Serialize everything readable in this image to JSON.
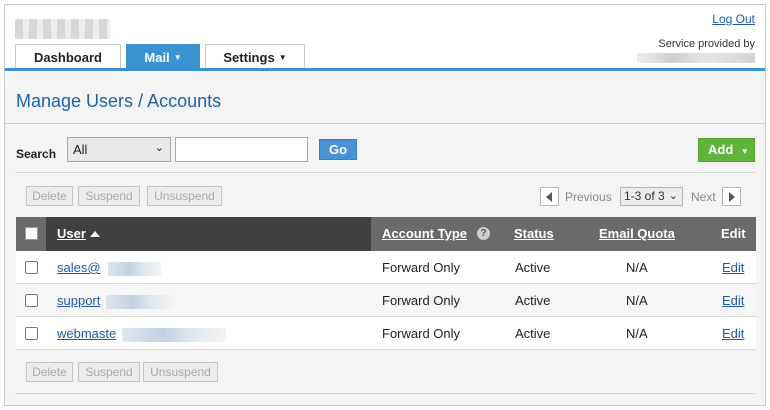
{
  "header": {
    "logout_label": "Log Out",
    "service_provided_label": "Service provided by"
  },
  "tabs": [
    {
      "label": "Dashboard",
      "active": false
    },
    {
      "label": "Mail",
      "active": true,
      "has_dropdown": true
    },
    {
      "label": "Settings",
      "active": false,
      "has_dropdown": true
    }
  ],
  "page_title": "Manage Users / Accounts",
  "toolbar": {
    "search_label": "Search",
    "filter_value": "All",
    "search_placeholder": "",
    "go_label": "Go",
    "add_label": "Add"
  },
  "bulk_actions": {
    "delete_label": "Delete",
    "suspend_label": "Suspend",
    "unsuspend_label": "Unsuspend"
  },
  "pager": {
    "prev_label": "Previous",
    "range_value": "1-3 of 3",
    "next_label": "Next"
  },
  "table": {
    "columns": {
      "user": "User",
      "account_type": "Account Type",
      "status": "Status",
      "email_quota": "Email Quota",
      "edit": "Edit"
    },
    "rows": [
      {
        "user": "sales@",
        "account_type": "Forward Only",
        "status": "Active",
        "email_quota": "N/A",
        "edit": "Edit"
      },
      {
        "user": "support",
        "account_type": "Forward Only",
        "status": "Active",
        "email_quota": "N/A",
        "edit": "Edit"
      },
      {
        "user": "webmaste",
        "account_type": "Forward Only",
        "status": "Active",
        "email_quota": "N/A",
        "edit": "Edit"
      }
    ]
  },
  "colors": {
    "accent_blue": "#3a92d0",
    "title_blue": "#1c63a8",
    "add_green": "#62b33c",
    "header_dark": "#404040",
    "header_gray": "#6a6a6a"
  }
}
